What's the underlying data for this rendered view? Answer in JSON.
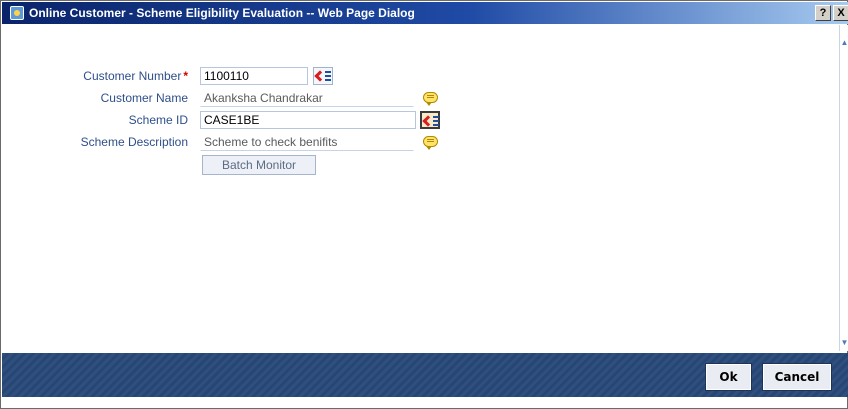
{
  "window": {
    "title": "Online Customer - Scheme Eligibility Evaluation -- Web Page Dialog",
    "help_label": "?",
    "close_label": "X"
  },
  "form": {
    "customer_number": {
      "label": "Customer Number",
      "required_mark": "*",
      "value": "1100110"
    },
    "customer_name": {
      "label": "Customer Name",
      "value": "Akanksha Chandrakar"
    },
    "scheme_id": {
      "label": "Scheme ID",
      "value": "CASE1BE"
    },
    "scheme_description": {
      "label": "Scheme Description",
      "value": "Scheme to check benifits"
    },
    "batch_monitor_label": "Batch Monitor"
  },
  "footer": {
    "ok_label": "Ok",
    "cancel_label": "Cancel"
  },
  "icons": {
    "lov": "list-of-values-icon",
    "description": "speech-bubble-icon",
    "scroll_up": "scroll-up-arrow-icon",
    "scroll_down": "scroll-down-arrow-icon"
  },
  "colors": {
    "titlebar": "#0a246a",
    "label_text": "#2e4f8a",
    "required": "#d40000",
    "footer": "#2f4f7f"
  }
}
